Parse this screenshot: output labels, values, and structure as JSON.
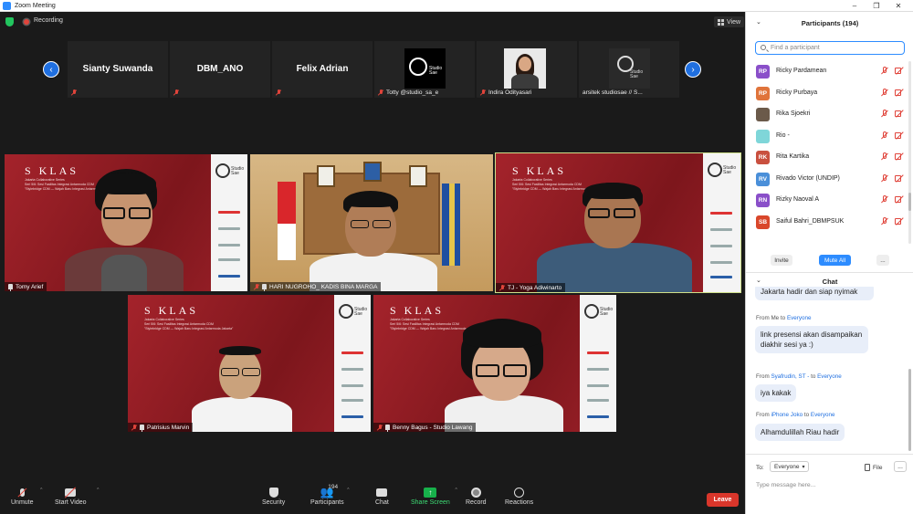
{
  "window": {
    "title": "Zoom Meeting"
  },
  "topbar": {
    "recording_label": "Recording",
    "view_label": "View"
  },
  "strip": {
    "thumbs": [
      {
        "name": "Sianty Suwanda",
        "display": ""
      },
      {
        "name": "DBM_ANO",
        "display": ""
      },
      {
        "name": "Felix Adrian",
        "display": ""
      },
      {
        "name": "",
        "display": "Totty @studio_sa_e",
        "logo_text": "Studio\nSae"
      },
      {
        "name": "",
        "display": "Indira Odityasari"
      },
      {
        "name": "",
        "display": "arsitek studiosae // S...",
        "logo_text": "Studio\nSae"
      }
    ]
  },
  "tiles": [
    {
      "label": "Tomy Arief",
      "sklas": "S KLAS",
      "sub1": "Jakarta Collaborative Series",
      "sub2": "Seri 5/6: Sesi Fasilitas Integrasi Antarmoda CDM",
      "sub3": "\"Stylebridge CDM — Wajah Baru Integrasi Antarmoda Jakarta\"",
      "logo": "Studio\nSae"
    },
    {
      "label": "HARI NUGROHO_ KADIS BINA MARGA"
    },
    {
      "label": "TJ - Yoga Adiwinarto",
      "sklas": "S KLAS",
      "sub1": "Jakarta Collaborative Series",
      "sub2": "Seri 5/6: Sesi Fasilitas Integrasi Antarmoda CDM",
      "sub3": "\"Stylebridge CDM — Wajah Baru Integrasi Antarmoda Jakarta\"",
      "logo": "Studio\nSae"
    },
    {
      "label": "Patrisius Marvin",
      "sklas": "S KLAS",
      "sub1": "Jakarta Collaborative Series",
      "sub2": "Seri 5/6: Sesi Fasilitas Integrasi Antarmoda CDM",
      "sub3": "\"Stylebridge CDM — Wajah Baru Integrasi Antarmoda Jakarta\"",
      "logo": "Studio\nSae"
    },
    {
      "label": "Benny Bagus - Studio Lawang",
      "sklas": "S KLAS",
      "sub1": "Jakarta Collaborative Series",
      "sub2": "Seri 5/6: Sesi Fasilitas Integrasi Antarmoda CDM",
      "sub3": "\"Stylebridge CDM — Wajah Baru Integrasi Antarmoda Jakarta\"",
      "logo": "Studio\nSae"
    }
  ],
  "toolbar": {
    "unmute": "Unmute",
    "start_video": "Start Video",
    "security": "Security",
    "participants": "Participants",
    "participants_count": "194",
    "chat": "Chat",
    "share_screen": "Share Screen",
    "record": "Record",
    "reactions": "Reactions",
    "leave": "Leave"
  },
  "participants_panel": {
    "title": "Participants (194)",
    "search_placeholder": "Find a participant",
    "rows": [
      {
        "initials": "RP",
        "name": "Ricky Pardamean",
        "color": "#8a4fc9"
      },
      {
        "initials": "RP",
        "name": "Ricky Purbaya",
        "color": "#e0743b"
      },
      {
        "initials": "",
        "name": "Rika Sjoekri",
        "color": "#6b5a4a"
      },
      {
        "initials": "",
        "name": "Rio -",
        "color": "#7fd6d9"
      },
      {
        "initials": "RK",
        "name": "Rita Kartika",
        "color": "#c9503f"
      },
      {
        "initials": "RV",
        "name": "Rivado Victor (UNDIP)",
        "color": "#4a8fd9"
      },
      {
        "initials": "RN",
        "name": "Rizky Naoval A",
        "color": "#8a4fc9"
      },
      {
        "initials": "SB",
        "name": "Saiful Bahri_DBMPSUK",
        "color": "#d9472b"
      }
    ],
    "invite": "Invite",
    "mute_all": "Mute All",
    "more": "..."
  },
  "chat": {
    "title": "Chat",
    "messages": [
      {
        "from": "",
        "to": "",
        "text": "Jakarta hadir dan siap nyimak"
      },
      {
        "from_prefix": "From Me to ",
        "to": "Everyone",
        "from_user": "",
        "text": "link presensi akan disampaikan diakhir sesi ya :)"
      },
      {
        "from_prefix": "From ",
        "from_user": "Syafrudin, ST -",
        "to_prefix": " to ",
        "to": "Everyone",
        "text": "iya kakak"
      },
      {
        "from_prefix": "From ",
        "from_user": "iPhone Joko",
        "to_prefix": " to ",
        "to": "Everyone",
        "text": "Alhamdulillah Riau hadir"
      }
    ],
    "to_label": "To:",
    "to_value": "Everyone",
    "file_label": "File",
    "more": "...",
    "input_placeholder": "Type message here..."
  },
  "colors": {
    "accent": "#2d8cff",
    "leave": "#d9362b",
    "share": "#17b14b",
    "slide_red": "#8e1b22"
  }
}
